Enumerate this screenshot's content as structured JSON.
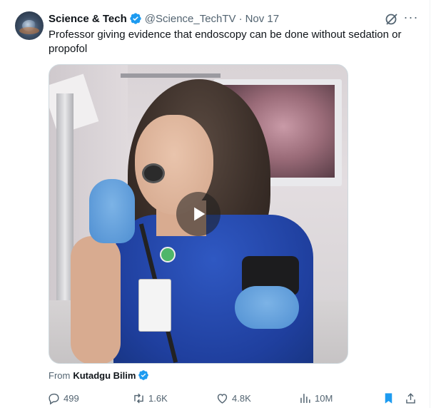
{
  "tweet": {
    "display_name": "Science & Tech",
    "handle": "@Science_TechTV",
    "separator": "·",
    "timestamp": "Nov 17",
    "text": "Professor giving evidence that endoscopy can be done without sedation or propofol",
    "more_label": "···"
  },
  "attribution": {
    "prefix": "From",
    "source_name": "Kutadgu Bilim"
  },
  "actions": {
    "reply_count": "499",
    "repost_count": "1.6K",
    "like_count": "4.8K",
    "view_count": "10M"
  },
  "colors": {
    "verified": "#1d9bf0",
    "text_primary": "#0f1419",
    "text_secondary": "#536471",
    "bookmark_active": "#1d9bf0"
  },
  "icons": {
    "verified": "verified-badge-icon",
    "grok": "grok-icon",
    "reply": "reply-icon",
    "repost": "repost-icon",
    "like": "heart-icon",
    "views": "views-icon",
    "bookmark": "bookmark-icon",
    "share": "share-icon",
    "play": "play-icon"
  }
}
